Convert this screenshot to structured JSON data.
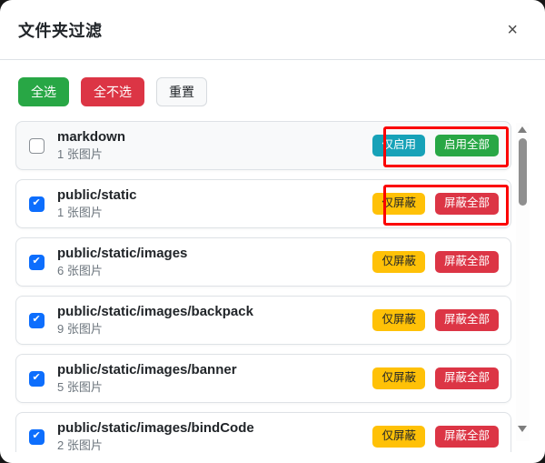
{
  "modal": {
    "title": "文件夹过滤",
    "close_icon": "×"
  },
  "toolbar": {
    "select_all_label": "全选",
    "deselect_all_label": "全不选",
    "reset_label": "重置"
  },
  "colors": {
    "success_green": "#28a745",
    "danger_red": "#dc3545",
    "info_teal": "#17a2b8",
    "warning_yellow": "#ffc107",
    "annotation_red": "#fb0000",
    "checkbox_checked_blue": "#0d6efd"
  },
  "folder_list": {
    "items": [
      {
        "name": "markdown",
        "count": "1 张图片",
        "checked": false,
        "muted_background": true,
        "annotated": true,
        "actions": [
          {
            "label": "仅启用",
            "type": "info",
            "name": "enable-only-button"
          },
          {
            "label": "启用全部",
            "type": "success",
            "name": "enable-all-button"
          }
        ]
      },
      {
        "name": "public/static",
        "count": "1 张图片",
        "checked": true,
        "muted_background": false,
        "annotated": true,
        "actions": [
          {
            "label": "仅屏蔽",
            "type": "warning",
            "name": "block-only-button"
          },
          {
            "label": "屏蔽全部",
            "type": "danger",
            "name": "block-all-button"
          }
        ]
      },
      {
        "name": "public/static/images",
        "count": "6 张图片",
        "checked": true,
        "muted_background": false,
        "annotated": false,
        "actions": [
          {
            "label": "仅屏蔽",
            "type": "warning",
            "name": "block-only-button"
          },
          {
            "label": "屏蔽全部",
            "type": "danger",
            "name": "block-all-button"
          }
        ]
      },
      {
        "name": "public/static/images/backpack",
        "count": "9 张图片",
        "checked": true,
        "muted_background": false,
        "annotated": false,
        "actions": [
          {
            "label": "仅屏蔽",
            "type": "warning",
            "name": "block-only-button"
          },
          {
            "label": "屏蔽全部",
            "type": "danger",
            "name": "block-all-button"
          }
        ]
      },
      {
        "name": "public/static/images/banner",
        "count": "5 张图片",
        "checked": true,
        "muted_background": false,
        "annotated": false,
        "actions": [
          {
            "label": "仅屏蔽",
            "type": "warning",
            "name": "block-only-button"
          },
          {
            "label": "屏蔽全部",
            "type": "danger",
            "name": "block-all-button"
          }
        ]
      },
      {
        "name": "public/static/images/bindCode",
        "count": "2 张图片",
        "checked": true,
        "muted_background": false,
        "annotated": false,
        "actions": [
          {
            "label": "仅屏蔽",
            "type": "warning",
            "name": "block-only-button"
          },
          {
            "label": "屏蔽全部",
            "type": "danger",
            "name": "block-all-button"
          }
        ]
      }
    ]
  }
}
